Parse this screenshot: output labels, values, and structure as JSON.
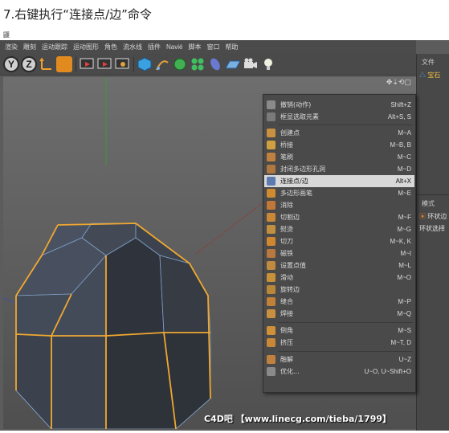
{
  "article": {
    "heading": "7.右键执行“连接点/边”命令",
    "small_glyph": "鼴"
  },
  "menubar": [
    "渲染",
    "雕刻",
    "运动跟踪",
    "运动图形",
    "角色",
    "流水线",
    "插件",
    "Navié",
    "脚本",
    "窗口",
    "帮助"
  ],
  "toolbar": {
    "y_label": "Y",
    "z_label": "Z"
  },
  "viewport": {
    "nav_icons": "✥⇣⟲▢"
  },
  "right_panel": {
    "file_tab": "文件",
    "object_name": "宝石",
    "mode_tab": "模式",
    "loop_label": "环状边",
    "loop_select": "环状选择"
  },
  "context_menu": {
    "groups": [
      [
        {
          "label": "撤销(动作)",
          "shortcut": "Shift+Z",
          "icon_color": "#8a8a8a"
        },
        {
          "label": "框显选取元素",
          "shortcut": "Alt+S, S",
          "icon_color": "#7a7a7a"
        }
      ],
      [
        {
          "label": "创建点",
          "shortcut": "M~A",
          "icon_color": "#c89040"
        },
        {
          "label": "桥接",
          "shortcut": "M~B, B",
          "icon_color": "#d0a040"
        },
        {
          "label": "笔刷",
          "shortcut": "M~C",
          "icon_color": "#c08040"
        },
        {
          "label": "封闭多边形孔洞",
          "shortcut": "M~D",
          "icon_color": "#b07840"
        },
        {
          "label": "连接点/边",
          "shortcut": "Alt+X",
          "icon_color": "#5a7ab0",
          "selected": true
        },
        {
          "label": "多边形画笔",
          "shortcut": "M~E",
          "icon_color": "#d08a30"
        },
        {
          "label": "消除",
          "shortcut": "",
          "icon_color": "#c07838"
        },
        {
          "label": "切割边",
          "shortcut": "M~F",
          "icon_color": "#c88838"
        },
        {
          "label": "熨烫",
          "shortcut": "M~G",
          "icon_color": "#c09040"
        },
        {
          "label": "切刀",
          "shortcut": "M~K, K",
          "icon_color": "#d08830"
        },
        {
          "label": "磁铁",
          "shortcut": "M~I",
          "icon_color": "#b87840"
        },
        {
          "label": "设置点值",
          "shortcut": "M~L",
          "icon_color": "#c08a40"
        },
        {
          "label": "滑动",
          "shortcut": "M~O",
          "icon_color": "#c89038"
        },
        {
          "label": "旋转边",
          "shortcut": "",
          "icon_color": "#b88838"
        },
        {
          "label": "缝合",
          "shortcut": "M~P",
          "icon_color": "#c08038"
        },
        {
          "label": "焊接",
          "shortcut": "M~Q",
          "icon_color": "#c89040"
        }
      ],
      [
        {
          "label": "倒角",
          "shortcut": "M~S",
          "icon_color": "#d09038"
        },
        {
          "label": "挤压",
          "shortcut": "M~T, D",
          "icon_color": "#c88838"
        }
      ],
      [
        {
          "label": "融解",
          "shortcut": "U~Z",
          "icon_color": "#c08040"
        },
        {
          "label": "优化...",
          "shortcut": "U~O, U~Shift+O",
          "icon_color": "#8a8a8a"
        }
      ]
    ]
  },
  "watermark": "C4D吧 【www.linecg.com/tieba/1799】",
  "colors": {
    "edge_highlight": "#f0a830",
    "mesh_face": "#3a3f48",
    "mesh_edge": "#7fa0c8"
  }
}
